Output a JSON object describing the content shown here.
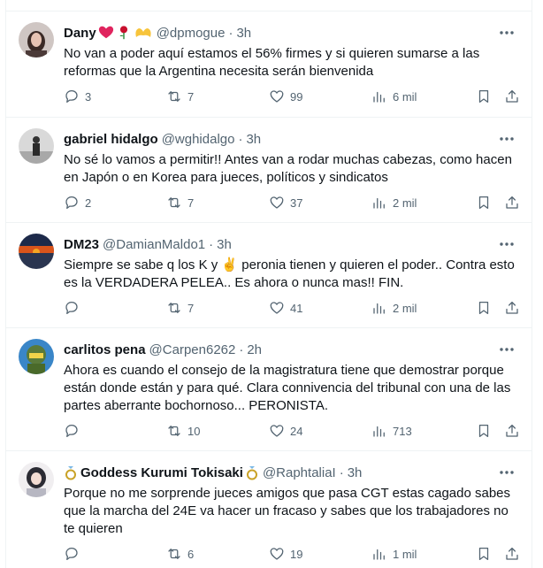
{
  "tweets": [
    {
      "name": "Dany",
      "name_suffix": "",
      "name_prefix": "",
      "handle": "@dpmogue",
      "time": "3h",
      "text": "No van a poder aquí estamos el 56% firmes y si quieren sumarse a las reformas que la Argentina necesita serán bienvenida",
      "replies": "3",
      "retweets": "7",
      "likes": "99",
      "views": "6 mil",
      "emojis": [
        "red-heart",
        "rose",
        "heart-hands"
      ]
    },
    {
      "name": "gabriel hidalgo",
      "name_suffix": "",
      "name_prefix": "",
      "handle": "@wghidalgo",
      "time": "3h",
      "text": "No sé lo vamos a permitir!! Antes van a rodar muchas cabezas, como hacen en Japón o en Korea para jueces, políticos y sindicatos",
      "replies": "2",
      "retweets": "7",
      "likes": "37",
      "views": "2 mil",
      "emojis": []
    },
    {
      "name": "DM23",
      "name_suffix": "",
      "name_prefix": "",
      "handle": "@DamianMaldo1",
      "time": "3h",
      "text": "Siempre se sabe q los K y ✌️ peronia tienen y quieren el poder.. Contra esto es la VERDADERA PELEA..  Es ahora o nunca mas!! FIN.",
      "replies": "",
      "retweets": "7",
      "likes": "41",
      "views": "2 mil",
      "emojis": []
    },
    {
      "name": "carlitos pena",
      "name_suffix": "",
      "name_prefix": "",
      "handle": "@Carpen6262",
      "time": "2h",
      "text": "Ahora es cuando el consejo de la magistratura tiene que demostrar porque están donde están y para qué. Clara connivencia del tribunal con una de las partes aberrante bochornoso... PERONISTA.",
      "replies": "",
      "retweets": "10",
      "likes": "24",
      "views": "713",
      "emojis": []
    },
    {
      "name": "Goddess Kurumi Tokisaki",
      "name_suffix": "",
      "name_prefix": "",
      "handle": "@RaphtaliaI",
      "time": "3h",
      "text": "Porque no me sorprende jueces amigos que pasa CGT estas cagado sabes que la marcha del 24E va hacer un fracaso y sabes que los trabajadores no te quieren",
      "replies": "",
      "retweets": "6",
      "likes": "19",
      "views": "1 mil",
      "emojis": [
        "ring",
        "ring"
      ]
    }
  ],
  "icons": {
    "reply": "reply-icon",
    "retweet": "retweet-icon",
    "like": "heart-icon",
    "views": "views-icon",
    "bookmark": "bookmark-icon",
    "share": "share-icon",
    "more": "more-icon"
  },
  "colors": {
    "text_primary": "#0f1419",
    "text_secondary": "#536471",
    "divider": "#eff3f4"
  }
}
